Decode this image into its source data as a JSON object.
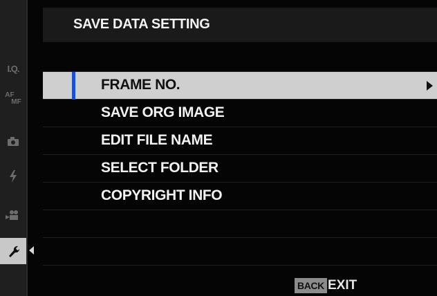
{
  "header": {
    "title": "SAVE DATA SETTING"
  },
  "rail": {
    "items": [
      {
        "name": "image-quality-icon",
        "text": "I.Q."
      },
      {
        "name": "af-mf-icon",
        "text_top": "AF",
        "text_bottom": "MF"
      },
      {
        "name": "camera-icon"
      },
      {
        "name": "flash-icon"
      },
      {
        "name": "movie-icon"
      },
      {
        "name": "wrench-icon",
        "active": true
      }
    ]
  },
  "menu": {
    "items": [
      {
        "label": "FRAME NO.",
        "selected": true
      },
      {
        "label": "SAVE ORG IMAGE"
      },
      {
        "label": "EDIT FILE NAME"
      },
      {
        "label": "SELECT FOLDER"
      },
      {
        "label": "COPYRIGHT INFO"
      }
    ]
  },
  "footer": {
    "back_label": "BACK",
    "exit_label": "EXIT"
  },
  "colors": {
    "selection_bg": "#cfcfcf",
    "selection_marker": "#1e4fd0",
    "text": "#f2f2f2"
  }
}
